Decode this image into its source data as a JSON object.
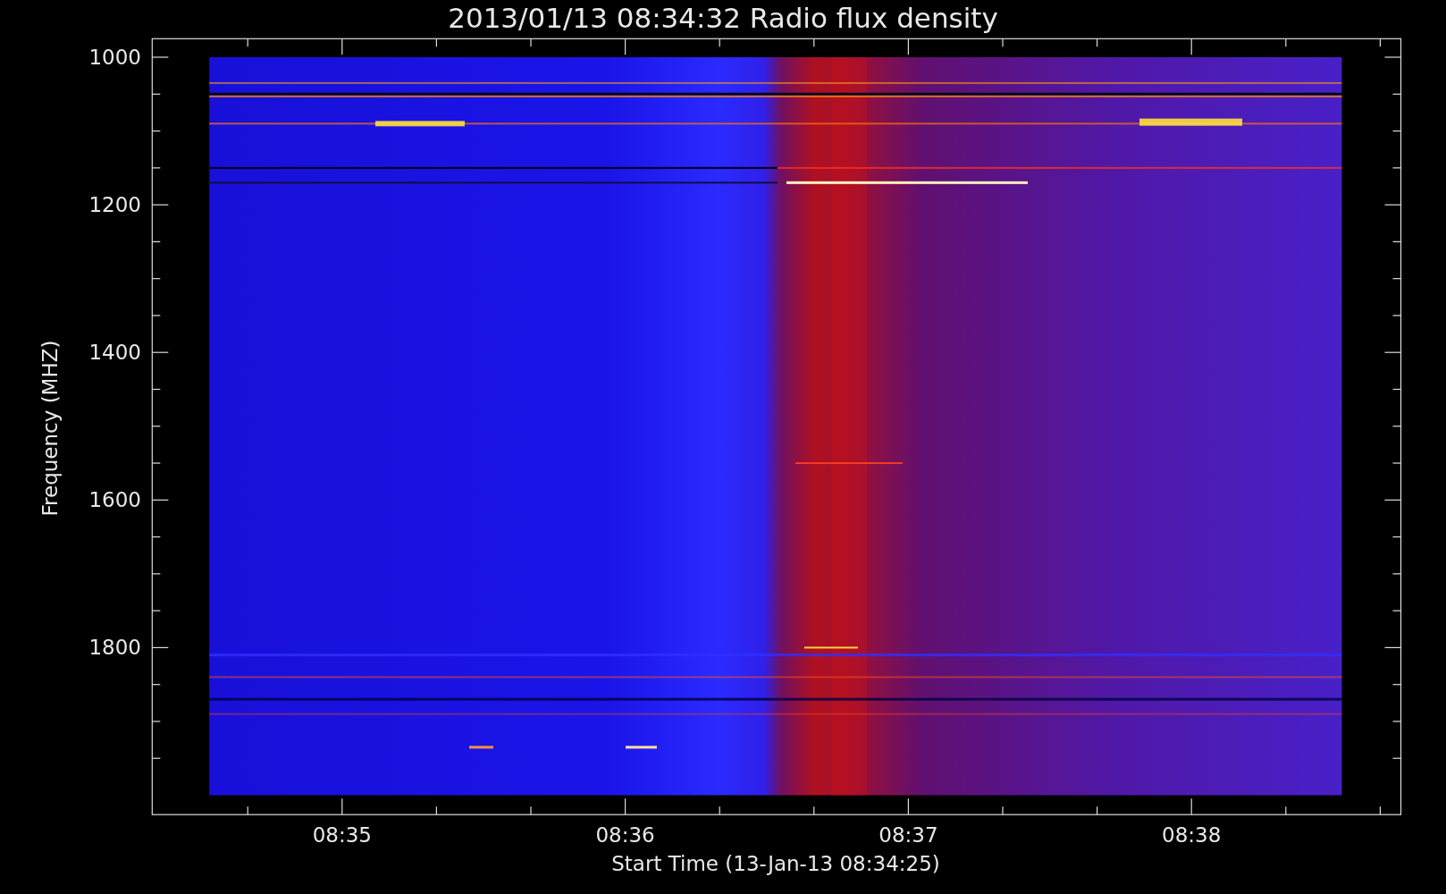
{
  "title": "2013/01/13 08:34:32 Radio flux density",
  "y_axis": {
    "label": "Frequency (MHZ)",
    "ticks": [
      "1000",
      "1200",
      "1400",
      "1600",
      "1800"
    ]
  },
  "x_axis": {
    "label": "Start Time (13-Jan-13 08:34:25)",
    "ticks": [
      "08:35",
      "08:36",
      "08:37",
      "08:38"
    ]
  }
}
